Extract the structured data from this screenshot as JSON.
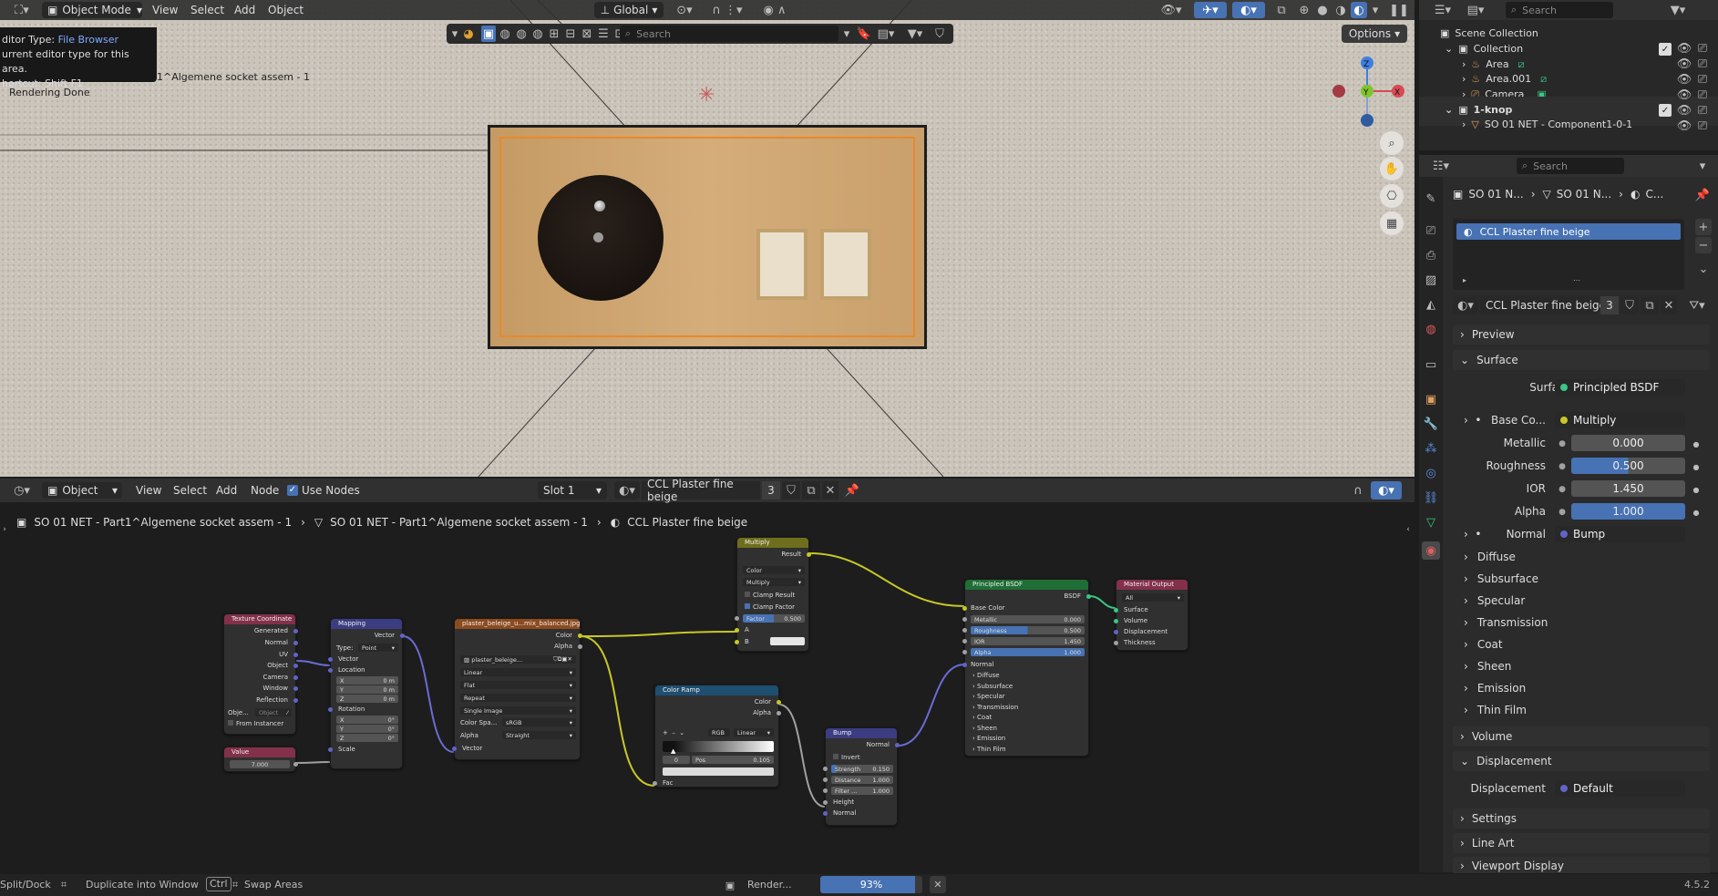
{
  "topbar": {
    "mode": "Object Mode",
    "menus": [
      "View",
      "Select",
      "Add",
      "Object"
    ],
    "orientation": "Global",
    "options": "Options"
  },
  "tooltip": {
    "line1_prefix": "ditor Type: ",
    "line1_value": "File Browser",
    "line2": "urrent editor type for this area.",
    "line3": "hortcut: Shift F1"
  },
  "viewport": {
    "object_label": "1^Algemene socket assem - 1",
    "status": "Rendering Done",
    "search_placeholder": "Search"
  },
  "node_header": {
    "editor": "Object",
    "menus": [
      "View",
      "Select",
      "Add",
      "Node"
    ],
    "use_nodes": "Use Nodes",
    "slot": "Slot 1",
    "material": "CCL Plaster fine beige",
    "users": "3"
  },
  "breadcrumb": {
    "item1": "SO 01 NET - Part1^Algemene socket assem - 1",
    "item2": "SO 01 NET - Part1^Algemene socket assem - 1",
    "item3": "CCL Plaster fine beige"
  },
  "nodes": {
    "texcoord": {
      "title": "Texture Coordinate",
      "outputs": [
        "Generated",
        "Normal",
        "UV",
        "Object",
        "Camera",
        "Window",
        "Reflection"
      ],
      "object_label": "Obje...",
      "object_field": "Object",
      "from_instancer": "From Instancer"
    },
    "value": {
      "title": "Value",
      "value": "7.000"
    },
    "mapping": {
      "title": "Mapping",
      "output": "Vector",
      "type_label": "Type:",
      "type_value": "Point",
      "vector": "Vector",
      "location": "Location",
      "loc": [
        [
          "X",
          "0 m"
        ],
        [
          "Y",
          "0 m"
        ],
        [
          "Z",
          "0 m"
        ]
      ],
      "rotation": "Rotation",
      "rot": [
        [
          "X",
          "0°"
        ],
        [
          "Y",
          "0°"
        ],
        [
          "Z",
          "0°"
        ]
      ],
      "scale": "Scale"
    },
    "image": {
      "title": "plaster_beleige_u...mix_balanced.jpg",
      "out_color": "Color",
      "out_alpha": "Alpha",
      "img_name": "plaster_beleige...",
      "interp": "Linear",
      "proj": "Flat",
      "ext": "Repeat",
      "src": "Single Image",
      "cs_label": "Color Spa...",
      "cs_value": "sRGB",
      "alpha_label": "Alpha",
      "alpha_value": "Straight",
      "vector": "Vector"
    },
    "multiply": {
      "title": "Multiply",
      "out": "Result",
      "type1": "Color",
      "type2": "Multiply",
      "clamp_result": "Clamp Result",
      "clamp_factor": "Clamp Factor",
      "factor_label": "Factor",
      "factor_value": "0.500",
      "a": "A",
      "b": "B"
    },
    "colorramp": {
      "title": "Color Ramp",
      "out_color": "Color",
      "out_alpha": "Alpha",
      "mode": "RGB",
      "interp": "Linear",
      "stop": "0",
      "pos_label": "Pos",
      "pos_value": "0.105",
      "fac": "Fac"
    },
    "bump": {
      "title": "Bump",
      "out": "Normal",
      "invert": "Invert",
      "strength_label": "Strength",
      "strength_value": "0.150",
      "distance_label": "Distance",
      "distance_value": "1.000",
      "filter_label": "Filter ...",
      "filter_value": "1.000",
      "height": "Height",
      "normal": "Normal"
    },
    "bsdf": {
      "title": "Principled BSDF",
      "out": "BSDF",
      "base_color": "Base Color",
      "metallic_label": "Metallic",
      "metallic_value": "0.000",
      "roughness_label": "Roughness",
      "roughness_value": "0.500",
      "ior_label": "IOR",
      "ior_value": "1.450",
      "alpha_label": "Alpha",
      "alpha_value": "1.000",
      "normal": "Normal",
      "panels": [
        "Diffuse",
        "Subsurface",
        "Specular",
        "Transmission",
        "Coat",
        "Sheen",
        "Emission",
        "Thin Film"
      ]
    },
    "output": {
      "title": "Material Output",
      "target": "All",
      "inputs": [
        "Surface",
        "Volume",
        "Displacement",
        "Thickness"
      ]
    }
  },
  "outliner": {
    "search": "Search",
    "items": [
      {
        "name": "Scene Collection"
      },
      {
        "name": "Collection"
      },
      {
        "name": "Area"
      },
      {
        "name": "Area.001"
      },
      {
        "name": "Camera"
      },
      {
        "name": "1-knop"
      },
      {
        "name": "SO 01 NET - Component1-0-1"
      }
    ]
  },
  "properties": {
    "search": "Search",
    "crumb": [
      "SO 01 N...",
      "SO 01 N...",
      "C..."
    ],
    "slot": "CCL Plaster fine beige",
    "material": "CCL Plaster fine beige",
    "users": "3",
    "preview": "Preview",
    "surface_panel": "Surface",
    "surface_label": "Surface",
    "surface_value": "Principled BSDF",
    "basecolor_label": "Base Co...",
    "basecolor_value": "Multiply",
    "metallic_label": "Metallic",
    "metallic_value": "0.000",
    "roughness_label": "Roughness",
    "roughness_value": "0.500",
    "ior_label": "IOR",
    "ior_value": "1.450",
    "alpha_label": "Alpha",
    "alpha_value": "1.000",
    "normal_label": "Normal",
    "normal_value": "Bump",
    "subpanels": [
      "Diffuse",
      "Subsurface",
      "Specular",
      "Transmission",
      "Coat",
      "Sheen",
      "Emission",
      "Thin Film"
    ],
    "volume": "Volume",
    "displacement_panel": "Displacement",
    "displacement_label": "Displacement",
    "displacement_value": "Default",
    "settings": "Settings",
    "lineart": "Line Art",
    "viewport_display": "Viewport Display"
  },
  "statusbar": {
    "split": "Split/Dock",
    "duplicate": "Duplicate into Window",
    "ctrl": "Ctrl",
    "swap": "Swap Areas",
    "render": "Render...",
    "progress_text": "93%",
    "progress": 0.93,
    "version": "4.5.2"
  }
}
